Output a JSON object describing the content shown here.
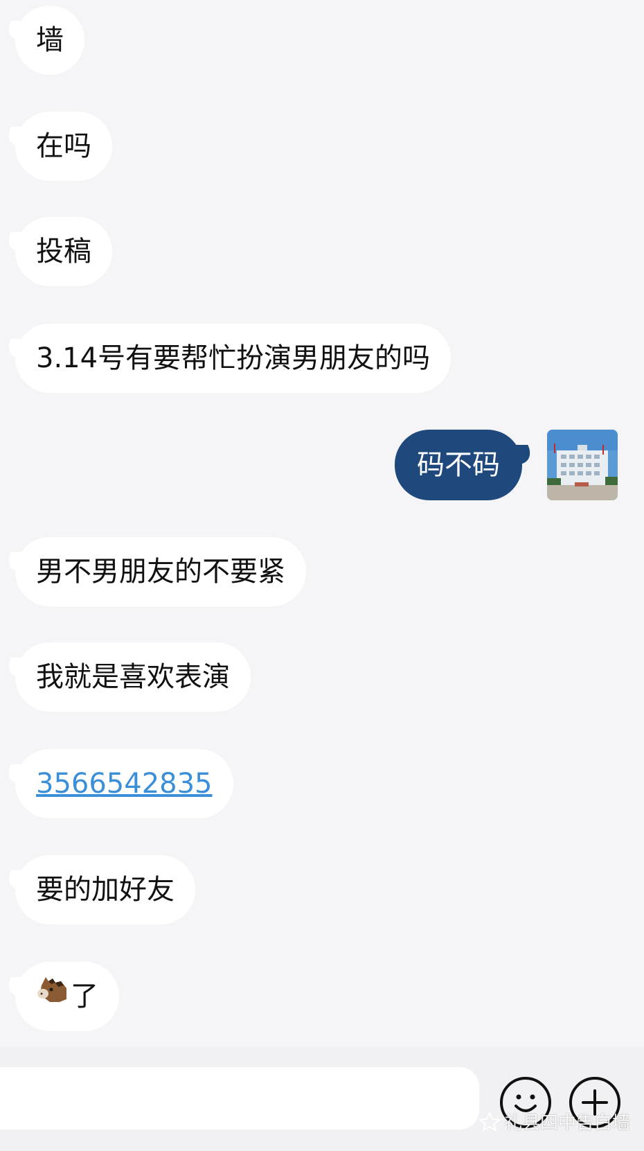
{
  "messages": [
    {
      "side": "left",
      "text": "墙"
    },
    {
      "side": "left",
      "text": "在吗"
    },
    {
      "side": "left",
      "text": "投稿"
    },
    {
      "side": "left",
      "text": "3.14号有要帮忙扮演男朋友的吗"
    },
    {
      "side": "right",
      "text": "码不码"
    },
    {
      "side": "left",
      "text": "男不男朋友的不要紧"
    },
    {
      "side": "left",
      "text": "我就是喜欢表演"
    },
    {
      "side": "left",
      "text": "3566542835",
      "kind": "link"
    },
    {
      "side": "left",
      "text": "要的加好友"
    },
    {
      "side": "left",
      "text": "了",
      "emoji": "horse-emoji"
    }
  ],
  "avatar": {
    "icon": "building-photo",
    "sky": "#5b9bd5",
    "building": "#e9eef2"
  },
  "input_bar": {
    "placeholder": "",
    "emoji_icon": "smile-icon",
    "add_icon": "plus-icon"
  },
  "watermark": {
    "text": "礼县四中告白墙",
    "icon": "app-logo-icon"
  },
  "colors": {
    "background": "#f5f5f7",
    "incoming_bubble": "#ffffff",
    "outgoing_bubble": "#1f497d",
    "link": "#3a8fd8"
  }
}
